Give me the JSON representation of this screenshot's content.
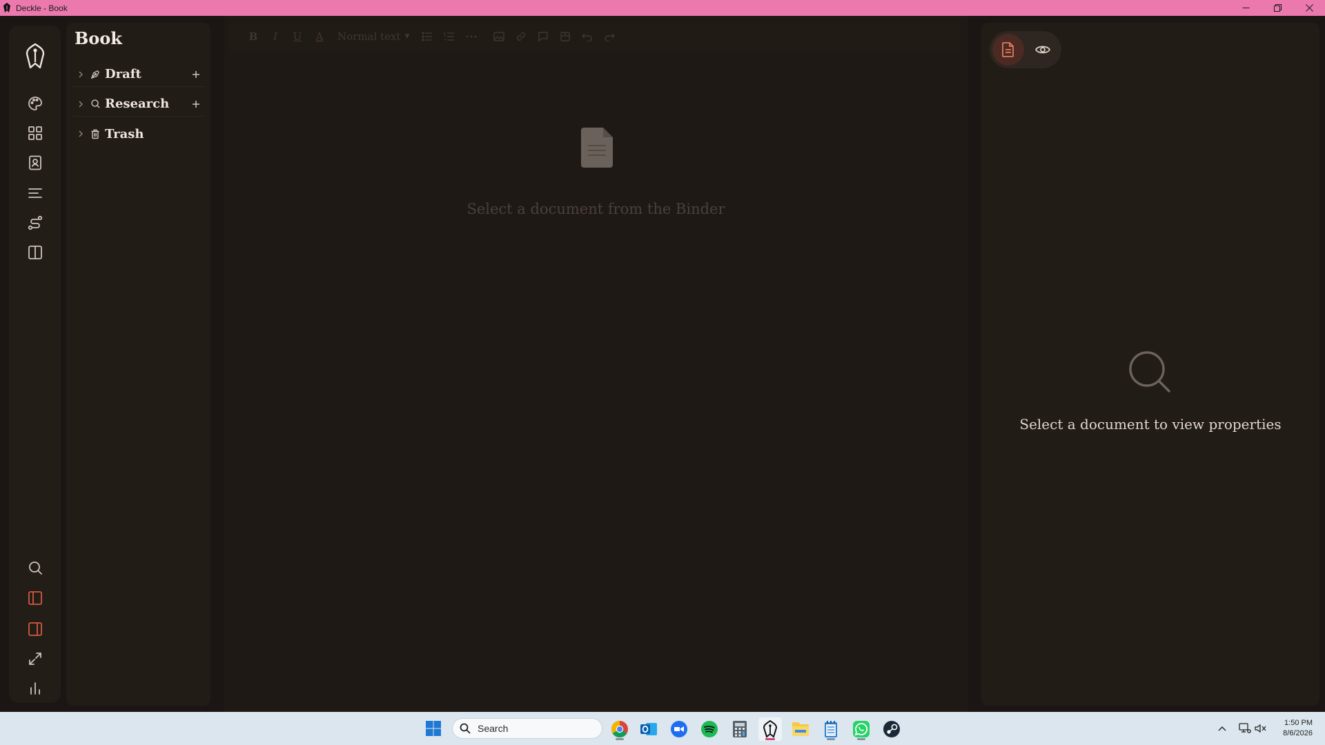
{
  "window": {
    "title": "Deckle - Book"
  },
  "binder": {
    "title": "Book",
    "items": [
      {
        "label": "Draft"
      },
      {
        "label": "Research"
      },
      {
        "label": "Trash"
      }
    ]
  },
  "editor": {
    "toolbar": {
      "bold": "B",
      "italic": "I",
      "underline": "U",
      "color": "A",
      "style_select": "Normal text"
    },
    "empty_message": "Select a document from the Binder"
  },
  "properties": {
    "empty_message": "Select a document to view properties"
  },
  "taskbar": {
    "search_label": "Search",
    "clock_time": "1:50 PM",
    "clock_date": "8/6/2026"
  },
  "colors": {
    "titlebar": "#ec79ad",
    "accent": "#d25a40",
    "background": "#1b1613",
    "panel": "#221c17"
  }
}
